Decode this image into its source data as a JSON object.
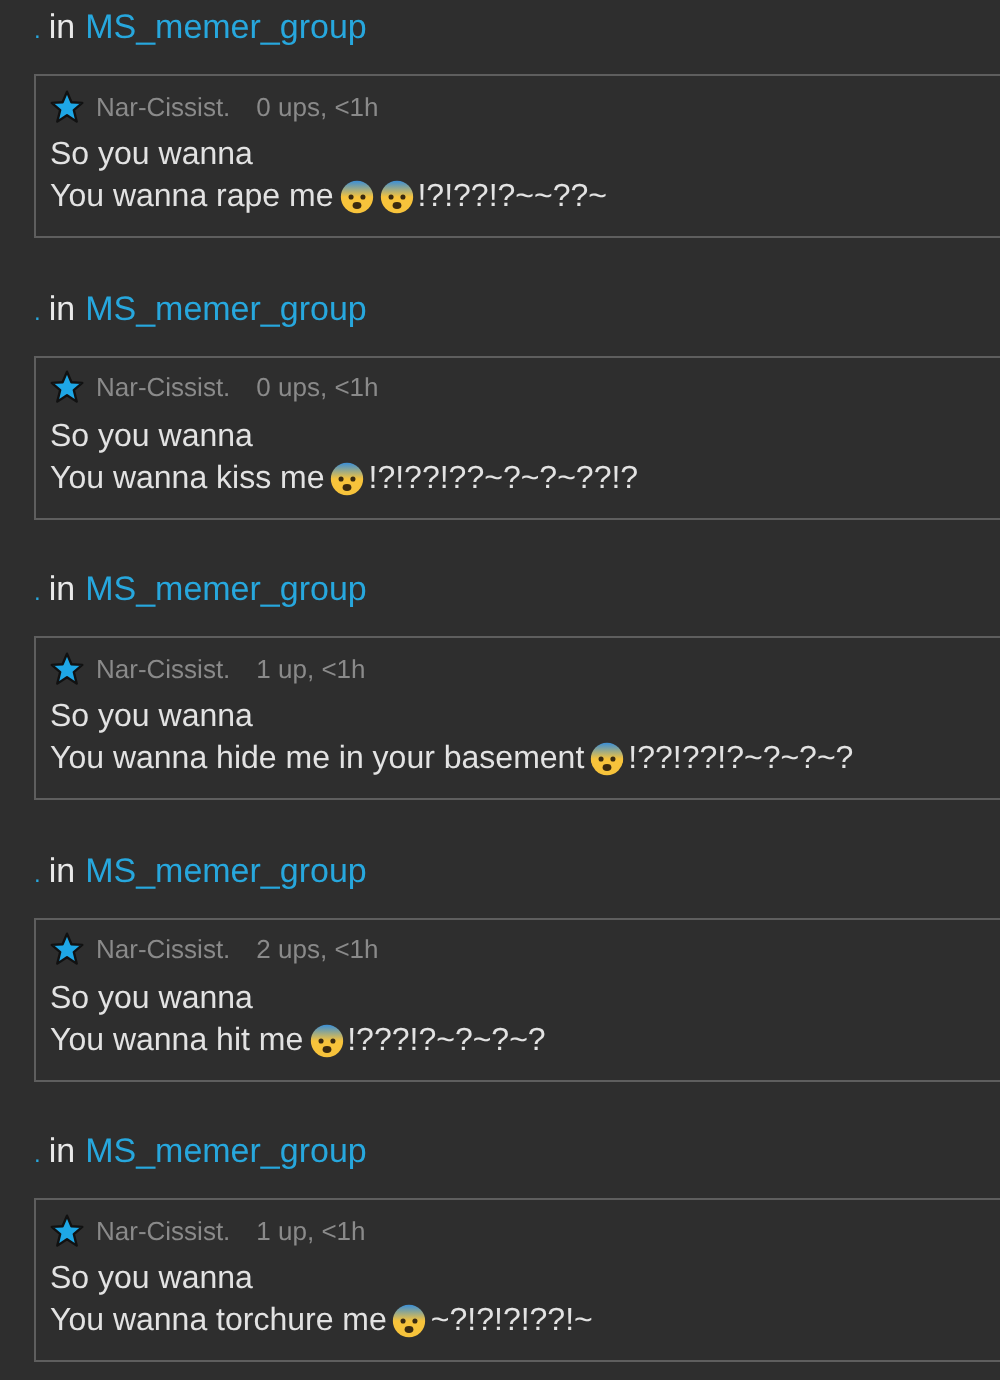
{
  "comments": [
    {
      "prefix": ".",
      "in": "in",
      "group": "MS_memer_group",
      "author": "Nar-Cissist.",
      "meta": "0 ups, <1h",
      "line1": "So you wanna",
      "line2": [
        {
          "kind": "text",
          "text": "You wanna rape me"
        },
        {
          "kind": "emoji"
        },
        {
          "kind": "emoji"
        },
        {
          "kind": "text",
          "text": "!?!??!?~~??~"
        }
      ]
    },
    {
      "prefix": ".",
      "in": "in",
      "group": "MS_memer_group",
      "author": "Nar-Cissist.",
      "meta": "0 ups, <1h",
      "line1": "So you wanna",
      "line2": [
        {
          "kind": "text",
          "text": "You wanna kiss me"
        },
        {
          "kind": "emoji"
        },
        {
          "kind": "text",
          "text": "!?!??!??~?~?~??!?"
        }
      ]
    },
    {
      "prefix": ".",
      "in": "in",
      "group": "MS_memer_group",
      "author": "Nar-Cissist.",
      "meta": "1 up, <1h",
      "line1": "So you wanna",
      "line2": [
        {
          "kind": "text",
          "text": "You wanna hide me in your basement"
        },
        {
          "kind": "emoji"
        },
        {
          "kind": "text",
          "text": "!??!??!?~?~?~?"
        }
      ]
    },
    {
      "prefix": ".",
      "in": "in",
      "group": "MS_memer_group",
      "author": "Nar-Cissist.",
      "meta": "2 ups, <1h",
      "line1": "So you wanna",
      "line2": [
        {
          "kind": "text",
          "text": "You wanna hit me"
        },
        {
          "kind": "emoji"
        },
        {
          "kind": "text",
          "text": "!???!?~?~?~?"
        }
      ]
    },
    {
      "prefix": ".",
      "in": "in",
      "group": "MS_memer_group",
      "author": "Nar-Cissist.",
      "meta": "1 up, <1h",
      "line1": "So you wanna",
      "line2": [
        {
          "kind": "text",
          "text": "You wanna torchure me"
        },
        {
          "kind": "emoji"
        },
        {
          "kind": "text",
          "text": "~?!?!?!??!~"
        }
      ]
    }
  ]
}
